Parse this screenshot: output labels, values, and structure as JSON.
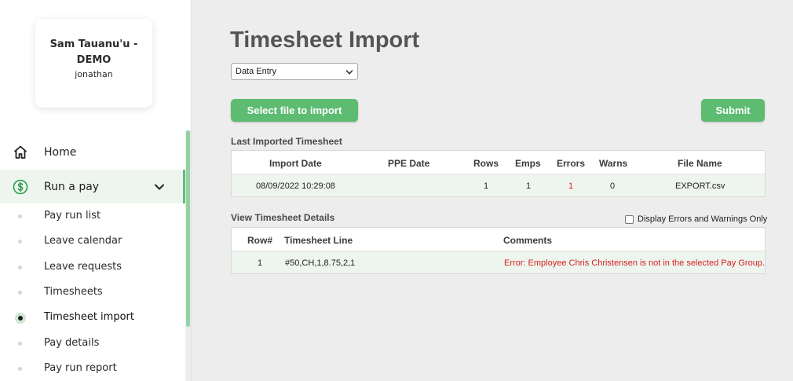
{
  "sidebar": {
    "profile": {
      "name_line1": "Sam Tauanu'u -",
      "name_line2": "DEMO",
      "username": "jonathan"
    },
    "nav": {
      "home": {
        "label": "Home",
        "icon": "home-icon"
      },
      "run_a_pay": {
        "label": "Run a pay",
        "icon": "dollar-circle-icon",
        "expanded": true
      }
    },
    "sub_items": [
      {
        "label": "Pay run list",
        "active": false
      },
      {
        "label": "Leave calendar",
        "active": false
      },
      {
        "label": "Leave requests",
        "active": false
      },
      {
        "label": "Timesheets",
        "active": false
      },
      {
        "label": "Timesheet import",
        "active": true
      },
      {
        "label": "Pay details",
        "active": false
      },
      {
        "label": "Pay run report",
        "active": false
      }
    ]
  },
  "main": {
    "title": "Timesheet Import",
    "mode_select": {
      "value": "Data Entry"
    },
    "select_file_button": "Select file to import",
    "submit_button": "Submit",
    "last_imported": {
      "title": "Last Imported Timesheet",
      "headers": [
        "Import Date",
        "PPE Date",
        "Rows",
        "Emps",
        "Errors",
        "Warns",
        "File Name"
      ],
      "row": {
        "import_date": "08/09/2022 10:29:08",
        "ppe_date": "",
        "rows": "1",
        "emps": "1",
        "errors": "1",
        "warns": "0",
        "file_name": "EXPORT.csv"
      }
    },
    "details": {
      "title": "View Timesheet Details",
      "filter_label": "Display Errors and Warnings Only",
      "filter_checked": false,
      "headers": [
        "Row#",
        "Timesheet Line",
        "Comments"
      ],
      "row": {
        "row_num": "1",
        "line": "#50,CH,1,8.75,2,1",
        "comment": "Error: Employee Chris Christensen is not in the selected Pay Group."
      }
    }
  },
  "colors": {
    "accent": "#5dbb72",
    "error": "#d42020",
    "row_highlight": "#eef5ef",
    "background": "#ededed"
  }
}
